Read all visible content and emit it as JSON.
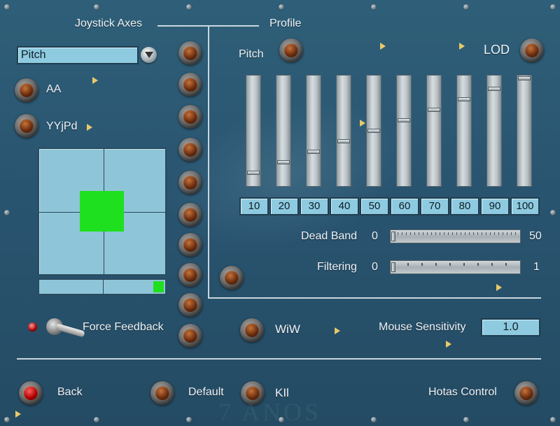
{
  "headers": {
    "axes": "Joystick Axes",
    "profile": "Profile"
  },
  "axis_select": {
    "value": "Pitch"
  },
  "left": {
    "aa": "AA",
    "yyjpd": "YYjPd",
    "force_feedback": "Force Feedback"
  },
  "profile": {
    "pitch": "Pitch",
    "lod": "LOD",
    "slider_values": [
      "10",
      "20",
      "30",
      "40",
      "50",
      "60",
      "70",
      "80",
      "90",
      "100"
    ],
    "dead_band": {
      "label": "Dead Band",
      "min": "0",
      "max": "50",
      "value": 0
    },
    "filtering": {
      "label": "Filtering",
      "min": "0",
      "max": "1",
      "value": 0
    }
  },
  "wiw": "WiW",
  "mouse_sensitivity": {
    "label": "Mouse Sensitivity",
    "value": "1.0"
  },
  "footer": {
    "back": "Back",
    "default": "Default",
    "kil": "KIl",
    "hotas": "Hotas Control"
  },
  "watermark": "7 ANOS",
  "colors": {
    "background": "#2f5f78",
    "field": "#8fcbe0",
    "indicator": "#1fe01f",
    "arrow": "#e8c96a"
  }
}
